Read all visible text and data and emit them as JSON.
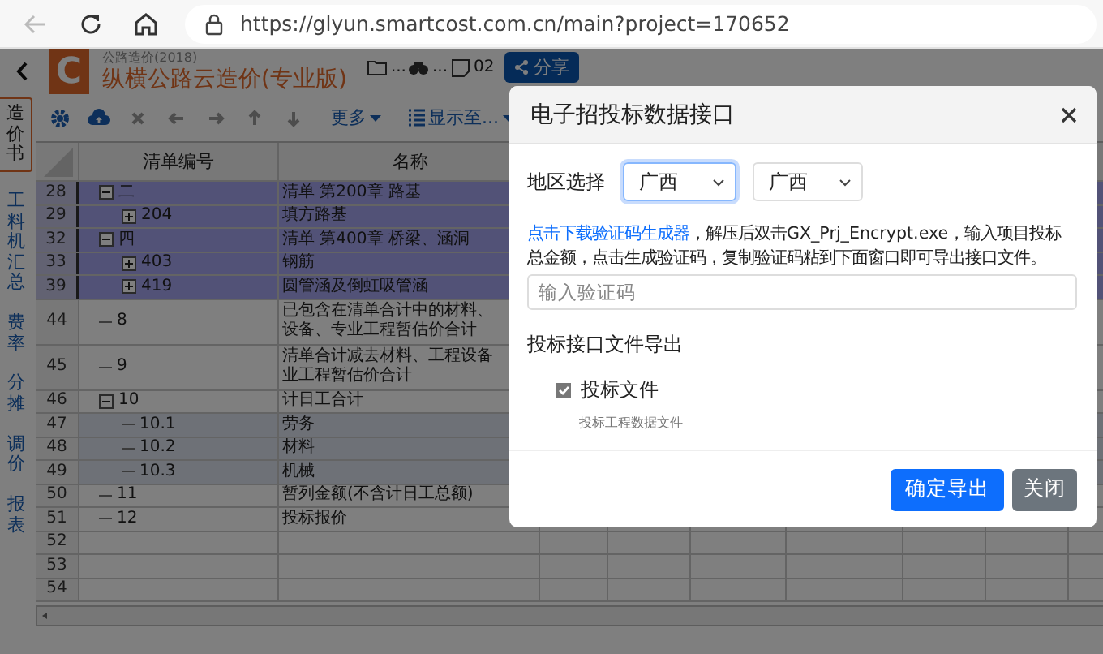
{
  "browser": {
    "back": {
      "disabled": true
    },
    "url": "https://glyun.smartcost.com.cn/main?project=170652"
  },
  "app": {
    "logo": "C",
    "subtitle": "公路造价(2018)",
    "title": "纵横公路云造价(专业版)",
    "path": [
      "...",
      "...",
      "02"
    ],
    "share": "分享"
  },
  "toolbar": {
    "icon_buttons": [
      {
        "disabled": false
      },
      {
        "disabled": false
      },
      {
        "disabled": true
      },
      {
        "disabled": true
      },
      {
        "disabled": true
      },
      {
        "disabled": true
      },
      {
        "disabled": true
      }
    ],
    "menus": [
      "更多",
      "显示至..."
    ]
  },
  "side_tabs": [
    {
      "label": "造价书",
      "selected": true
    },
    {
      "label": "工料机汇总",
      "selected": false
    },
    {
      "label": "费率",
      "selected": false
    },
    {
      "label": "分摊",
      "selected": false
    },
    {
      "label": "调价",
      "selected": false
    },
    {
      "label": "报表",
      "selected": false
    }
  ],
  "table": {
    "columns": [
      "清单编号",
      "名称"
    ],
    "rows": [
      {
        "no": "28",
        "code": "二",
        "name": [
          "清单 第200章 路基"
        ],
        "selected": true,
        "expanded": true,
        "children": [
          {
            "no": "29",
            "code": "204",
            "name": [
              "填方路基"
            ],
            "selected": true,
            "expanded": false
          }
        ]
      },
      {
        "no": "32",
        "code": "四",
        "name": [
          "清单 第400章 桥梁、涵洞"
        ],
        "selected": true,
        "expanded": true,
        "children": [
          {
            "no": "33",
            "code": "403",
            "name": [
              "钢筋"
            ],
            "selected": true,
            "expanded": false
          },
          {
            "no": "39",
            "code": "419",
            "name": [
              "圆管涵及倒虹吸管涵"
            ],
            "selected": true,
            "expanded": false
          }
        ]
      },
      {
        "no": "44",
        "code": "8",
        "name": [
          "已包含在清单合计中的材料、",
          "设备、专业工程暂估价合计"
        ],
        "selected": false,
        "shaded": false
      },
      {
        "no": "45",
        "code": "9",
        "name": [
          "清单合计减去材料、工程设备",
          "业工程暂估价合计"
        ],
        "selected": false,
        "shaded": false
      },
      {
        "no": "46",
        "code": "10",
        "name": [
          "计日工合计"
        ],
        "selected": false,
        "shaded": false,
        "expanded": true,
        "children": [
          {
            "no": "47",
            "code": "10.1",
            "name": [
              "劳务"
            ],
            "selected": false,
            "shaded": true
          },
          {
            "no": "48",
            "code": "10.2",
            "name": [
              "材料"
            ],
            "selected": false,
            "shaded": true
          },
          {
            "no": "49",
            "code": "10.3",
            "name": [
              "机械"
            ],
            "selected": false,
            "shaded": true
          }
        ]
      },
      {
        "no": "50",
        "code": "11",
        "name": [
          "暂列金额(不含计日工总额)"
        ],
        "selected": false,
        "shaded": false
      },
      {
        "no": "51",
        "code": "12",
        "name": [
          "投标报价"
        ],
        "selected": false,
        "shaded": false
      },
      {
        "no": "52",
        "selected": false,
        "shaded": false
      },
      {
        "no": "53",
        "selected": false,
        "shaded": false
      },
      {
        "no": "54",
        "selected": false,
        "shaded": false
      }
    ]
  },
  "dialog": {
    "title": "电子招投标数据接口",
    "region_label": "地区选择",
    "selects": [
      {
        "value": "广西",
        "focused": true
      },
      {
        "value": "广西",
        "focused": false
      }
    ],
    "link": "点击下载验证码生成器",
    "instructions": "，解压后双击GX_Prj_Encrypt.exe，输入项目投标总金额，点击生成验证码，复制验证码粘到下面窗口即可导出接口文件。",
    "code_field": {
      "placeholder": "输入验证码"
    },
    "export_label": "投标接口文件导出",
    "files": [
      {
        "label": "投标文件",
        "checked": true,
        "description": "投标工程数据文件"
      }
    ],
    "buttons": [
      {
        "label": "确定导出",
        "kind": "primary"
      },
      {
        "label": "关闭",
        "kind": "secondary"
      }
    ]
  }
}
